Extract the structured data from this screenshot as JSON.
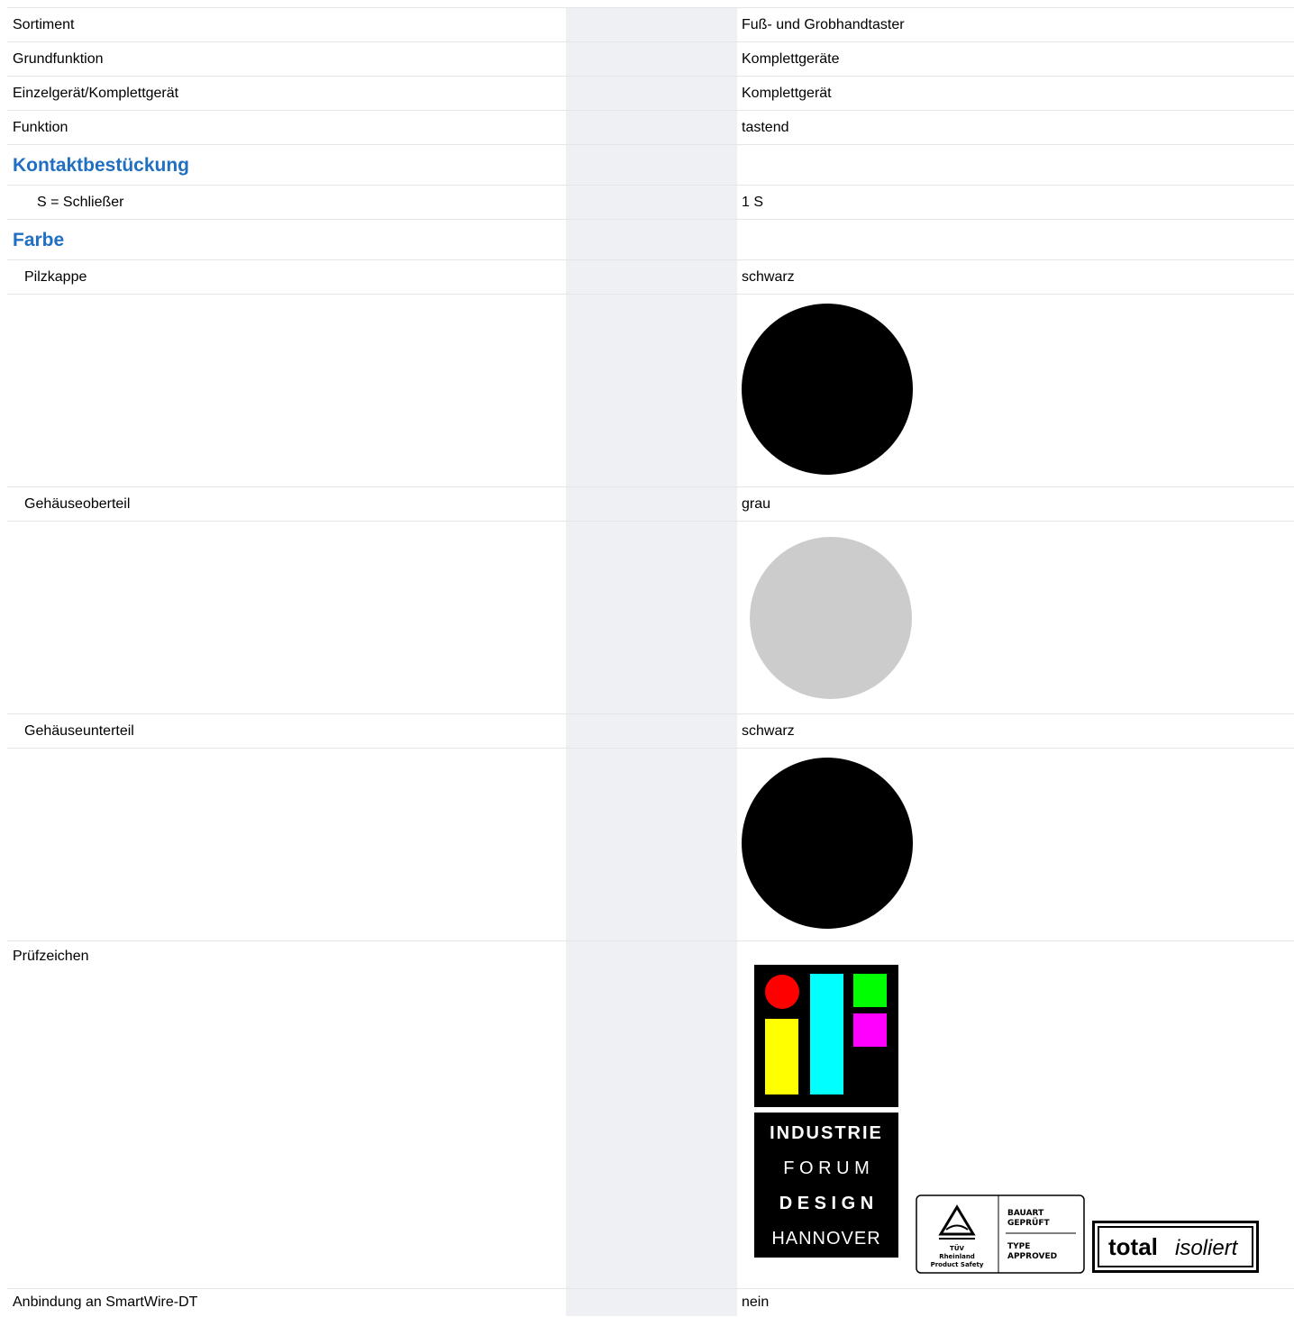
{
  "rows": [
    {
      "label": "Sortiment",
      "value": "Fuß- und Grobhandtaster"
    },
    {
      "label": "Grundfunktion",
      "value": "Komplettgeräte"
    },
    {
      "label": "Einzelgerät/Komplettgerät",
      "value": "Komplettgerät"
    },
    {
      "label": "Funktion",
      "value": "tastend"
    }
  ],
  "section_contacts": {
    "title": "Kontaktbestückung",
    "label": "S = Schließer",
    "value": "1 S"
  },
  "section_color": {
    "title": "Farbe",
    "items": [
      {
        "label": "Pilzkappe",
        "value": "schwarz",
        "swatch": "#000000"
      },
      {
        "label": "Gehäuseoberteil",
        "value": "grau",
        "swatch": "#cccccc"
      },
      {
        "label": "Gehäuseunterteil",
        "value": "schwarz",
        "swatch": "#000000"
      }
    ]
  },
  "test_marks": {
    "label": "Prüfzeichen",
    "ifd_lines": [
      "INDUSTRIE",
      "F O R U M",
      "D E S I G N",
      "HANNOVER"
    ],
    "tuv": {
      "brand": "TÜV",
      "brand2": "Rheinland",
      "brand3": "Product Safety",
      "line1": "BAUART",
      "line2": "GEPRÜFT",
      "line3": "TYPE",
      "line4": "APPROVED"
    },
    "total": {
      "word1": "total",
      "word2": "isoliert"
    }
  },
  "smartwire": {
    "label": "Anbindung an SmartWire-DT",
    "value": "nein"
  }
}
